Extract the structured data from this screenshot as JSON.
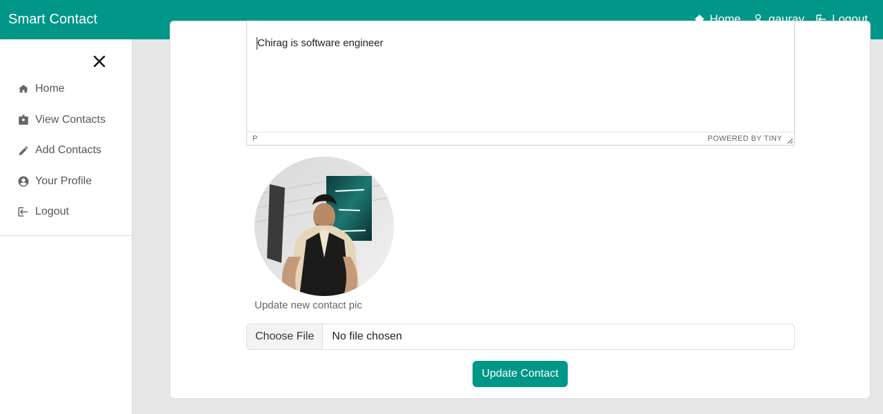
{
  "app": {
    "brand": "Smart Contact"
  },
  "nav": {
    "home": "Home",
    "user": "gaurav",
    "logout": "Logout"
  },
  "sidebar": {
    "close_icon": "close-icon",
    "items": [
      {
        "label": "Home",
        "icon": "home-icon"
      },
      {
        "label": "View Contacts",
        "icon": "id-badge-icon"
      },
      {
        "label": "Add Contacts",
        "icon": "pencil-icon"
      },
      {
        "label": "Your Profile",
        "icon": "user-circle-icon"
      },
      {
        "label": "Logout",
        "icon": "logout-icon"
      }
    ]
  },
  "form": {
    "description": "Chirag is software engineer",
    "editor_path": "P",
    "editor_powered": "POWERED BY TINY",
    "image_label": "Update new contact pic",
    "file_button": "Choose File",
    "file_status": "No file chosen",
    "submit": "Update Contact"
  },
  "colors": {
    "primary": "#009688",
    "background": "#e6e6e6"
  }
}
